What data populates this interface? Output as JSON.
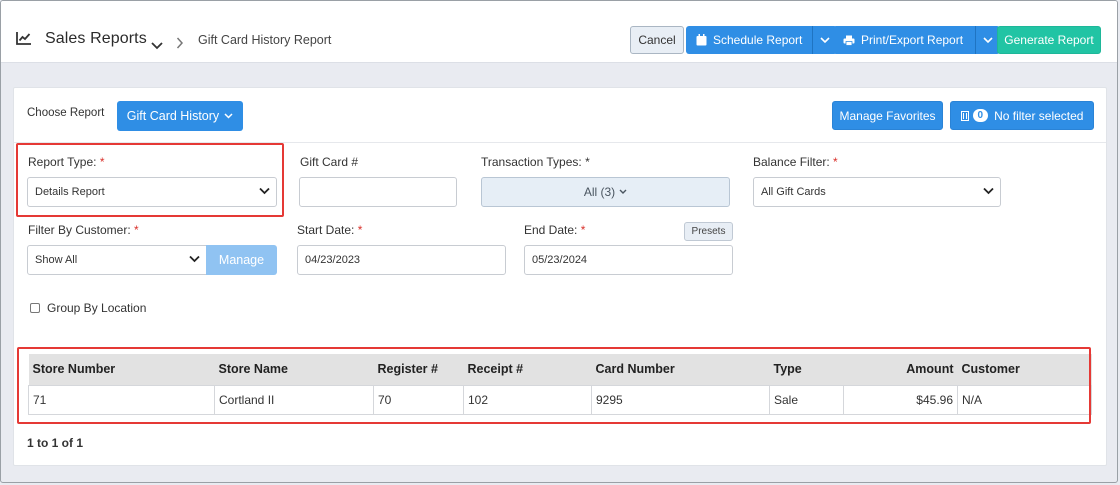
{
  "header": {
    "section_icon": "chart-line-icon",
    "section_title": "Sales Reports",
    "breadcrumb_current": "Gift Card History Report",
    "buttons": {
      "cancel": "Cancel",
      "schedule": "Schedule Report",
      "print_export": "Print/Export Report",
      "generate": "Generate Report"
    }
  },
  "toolbar": {
    "choose_report_label": "Choose Report",
    "report_dropdown": "Gift Card History",
    "manage_favorites": "Manage Favorites",
    "filter_count": "0",
    "filter_text": "No filter selected"
  },
  "filters": {
    "report_type": {
      "label": "Report Type:",
      "required": "*",
      "value": "Details Report"
    },
    "gift_card": {
      "label": "Gift Card #",
      "value": ""
    },
    "transaction_types": {
      "label": "Transaction Types:",
      "required": "*",
      "value": "All (3)"
    },
    "balance_filter": {
      "label": "Balance Filter:",
      "required": "*",
      "value": "All Gift Cards"
    },
    "filter_by_customer": {
      "label": "Filter By Customer:",
      "required": "*",
      "value": "Show All",
      "manage_button": "Manage"
    },
    "start_date": {
      "label": "Start Date:",
      "required": "*",
      "value": "04/23/2023"
    },
    "end_date": {
      "label": "End Date:",
      "required": "*",
      "value": "05/23/2024",
      "presets_button": "Presets"
    },
    "group_by_location": {
      "label": "Group By Location",
      "checked": false
    }
  },
  "table": {
    "columns": [
      "Store Number",
      "Store Name",
      "Register #",
      "Receipt #",
      "Card Number",
      "Type",
      "Amount",
      "Customer"
    ],
    "rows": [
      [
        "71",
        "Cortland II",
        "70",
        "102",
        "9295",
        "Sale",
        "$45.96",
        "N/A"
      ]
    ]
  },
  "pagination": {
    "text": "1 to 1 of 1"
  },
  "colors": {
    "primary": "#2f8ee5",
    "accent_teal": "#21c4a4",
    "highlight": "#e53935",
    "required": "#d9302a"
  }
}
